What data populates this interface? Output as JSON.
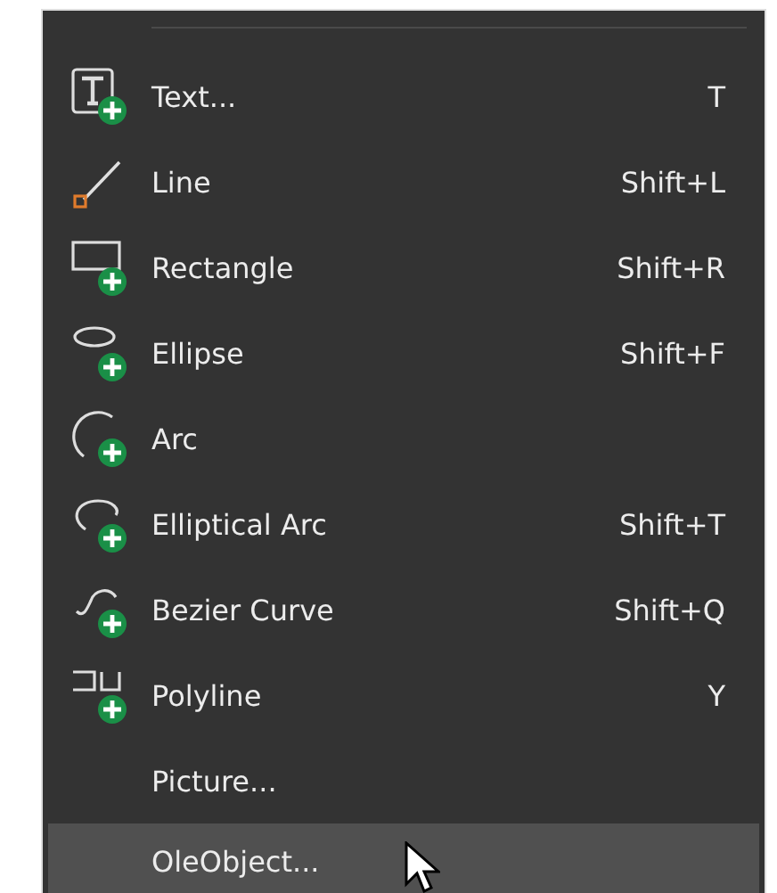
{
  "menu": {
    "items": [
      {
        "label": "Text...",
        "shortcut": "T",
        "kind": "text",
        "selected": false
      },
      {
        "label": "Line",
        "shortcut": "Shift+L",
        "kind": "line",
        "selected": false
      },
      {
        "label": "Rectangle",
        "shortcut": "Shift+R",
        "kind": "rectangle",
        "selected": false
      },
      {
        "label": "Ellipse",
        "shortcut": "Shift+F",
        "kind": "ellipse",
        "selected": false
      },
      {
        "label": "Arc",
        "kind": "arc",
        "selected": false
      },
      {
        "label": "Elliptical Arc",
        "shortcut": "Shift+T",
        "kind": "elliptical-arc",
        "selected": false
      },
      {
        "label": "Bezier Curve",
        "shortcut": "Shift+Q",
        "kind": "bezier",
        "selected": false
      },
      {
        "label": "Polyline",
        "shortcut": "Y",
        "kind": "polyline",
        "selected": false
      },
      {
        "label": "Picture...",
        "kind": "plain",
        "selected": false
      },
      {
        "label": "OleObject...",
        "kind": "plain",
        "selected": true
      }
    ]
  }
}
